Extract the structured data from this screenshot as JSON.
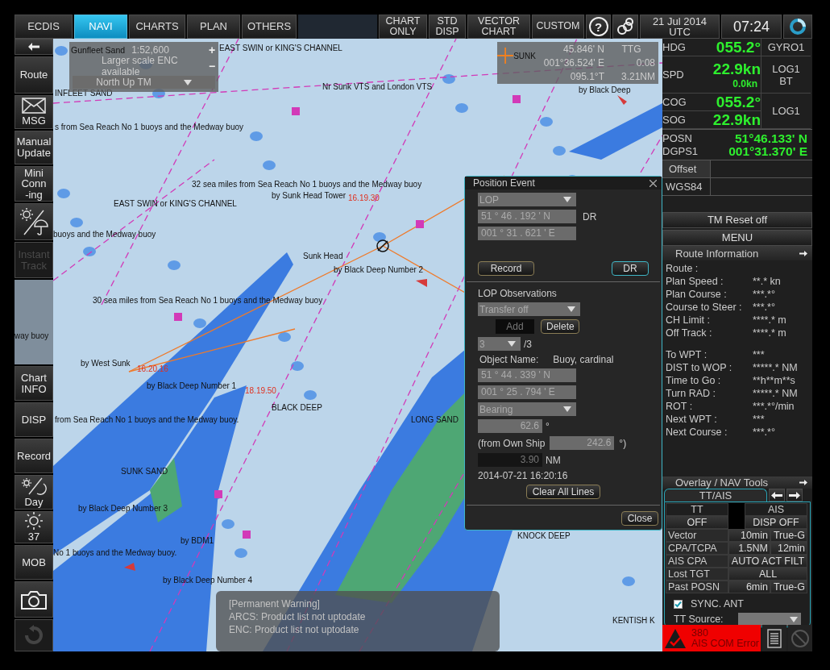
{
  "top_bar": {
    "tabs": [
      {
        "label": "ECDIS",
        "selected": false
      },
      {
        "label": "NAVI",
        "selected": true
      },
      {
        "label": "CHARTS",
        "selected": false
      },
      {
        "label": "PLAN",
        "selected": false
      },
      {
        "label": "OTHERS",
        "selected": false
      }
    ],
    "view_buttons": [
      {
        "lines": [
          "CHART",
          "ONLY"
        ]
      },
      {
        "lines": [
          "STD",
          "DISP"
        ]
      },
      {
        "lines": [
          "VECTOR",
          "CHART"
        ]
      },
      {
        "lines": [
          "CUSTOM"
        ]
      }
    ],
    "help": "?",
    "date": "21 Jul 2014",
    "zone": "UTC",
    "time": "07:24"
  },
  "sidebar": [
    {
      "kind": "back",
      "disabled": false
    },
    {
      "kind": "text",
      "lines": [
        "Route"
      ],
      "disabled": false
    },
    {
      "kind": "envelope",
      "lines": [
        "MSG"
      ],
      "disabled": false
    },
    {
      "kind": "text",
      "lines": [
        "Manual",
        "Update"
      ],
      "disabled": false
    },
    {
      "kind": "text",
      "lines": [
        "Mini",
        "Conn",
        "-ing"
      ],
      "disabled": false
    },
    {
      "kind": "weather",
      "disabled": false
    },
    {
      "kind": "text",
      "lines": [
        "Instant",
        "Track"
      ],
      "disabled": true
    },
    {
      "kind": "gap"
    },
    {
      "kind": "text",
      "lines": [
        "Chart",
        "INFO"
      ],
      "disabled": false
    },
    {
      "kind": "text",
      "lines": [
        "DISP"
      ],
      "disabled": false
    },
    {
      "kind": "text",
      "lines": [
        "Record"
      ],
      "disabled": false
    },
    {
      "kind": "daynight",
      "lines": [
        "Day"
      ],
      "disabled": false
    },
    {
      "kind": "brightness",
      "lines": [
        "37"
      ],
      "disabled": false
    },
    {
      "kind": "text",
      "lines": [
        "MOB"
      ],
      "disabled": false
    },
    {
      "kind": "camera",
      "disabled": false
    },
    {
      "kind": "undo",
      "disabled": true
    }
  ],
  "chart": {
    "scale_box": {
      "place": "Gunfleet Sand",
      "scale": "1:52,600",
      "notice": "Larger scale ENC available",
      "orientation": "North  Up TM",
      "zoom_in": "+",
      "zoom_out": "−"
    },
    "cursor_box": {
      "target": "SUNK",
      "lat": "45.846' N",
      "lon": "001°36.524' E",
      "bearing": "095.1°T",
      "ttg_label": "TTG",
      "ttg": "0:08",
      "distance": "3.21NM"
    },
    "labels": [
      {
        "text": "EAST SWIN or KING'S CHANNEL",
        "kind": "name"
      },
      {
        "text": "INFLEET SAND",
        "kind": "name"
      },
      {
        "text": "Nr Sunk VTS and London VTS",
        "kind": "name"
      },
      {
        "text": "by Black Deep",
        "kind": "name"
      },
      {
        "text": "s from Sea Reach No 1 buoys and the Medway buoy",
        "kind": "name"
      },
      {
        "text": "32 sea miles from Sea Reach No 1 buoys and the Medway buoy",
        "kind": "name"
      },
      {
        "text": "by Sunk Head Tower",
        "kind": "name"
      },
      {
        "text": "16.19.30",
        "kind": "time"
      },
      {
        "text": "EAST SWIN or KING'S CHANNEL",
        "kind": "name"
      },
      {
        "text": "buoys and the Medway buoy",
        "kind": "name"
      },
      {
        "text": "Sunk Head",
        "kind": "name"
      },
      {
        "text": "by Black Deep Number 2",
        "kind": "name"
      },
      {
        "text": "30 sea miles from Sea Reach No 1 buoys and the Medway buoy",
        "kind": "name"
      },
      {
        "text": "way buoy",
        "kind": "name"
      },
      {
        "text": "by West Sunk",
        "kind": "name"
      },
      {
        "text": "16.20.16",
        "kind": "time"
      },
      {
        "text": "by Black Deep Number 1",
        "kind": "name"
      },
      {
        "text": "18.19.50",
        "kind": "time"
      },
      {
        "text": "BLACK DEEP",
        "kind": "name"
      },
      {
        "text": "from Sea Reach No 1 buoys and the Medway buoy.",
        "kind": "name"
      },
      {
        "text": "LONG SAND",
        "kind": "name"
      },
      {
        "text": "SUNK SAND",
        "kind": "name"
      },
      {
        "text": "by Black Deep Number 3",
        "kind": "name"
      },
      {
        "text": "KNOCK DEEP",
        "kind": "name"
      },
      {
        "text": "by BDM1",
        "kind": "name"
      },
      {
        "text": "No 1 buoys and the Medway buoy.",
        "kind": "name"
      },
      {
        "text": "by Black Deep Number 4",
        "kind": "name"
      },
      {
        "text": "KENTISH K",
        "kind": "name"
      }
    ],
    "warning": {
      "title": "[Permanent Warning]",
      "lines": [
        "ARCS: Product list not uptodate",
        "ENC: Product list not uptodate"
      ]
    }
  },
  "position_event": {
    "title": "Position Event",
    "mode": "LOP",
    "lat": "51 ° 46 . 192 ' N",
    "lat_note": "DR",
    "lon": "001 ° 31 . 621 ' E",
    "buttons": [
      {
        "label": "Record",
        "selected": false
      },
      {
        "label": "DR",
        "selected": true
      }
    ],
    "section": "LOP Observations",
    "transfer": "Transfer off",
    "add": {
      "label": "Add",
      "disabled": true
    },
    "delete": {
      "label": "Delete",
      "disabled": false
    },
    "index": "3",
    "count": "/3",
    "object_label": "Object Name:",
    "object_value": "Buoy, cardinal",
    "obj_lat": "51 ° 44 . 339 ' N",
    "obj_lon": "001 ° 25 . 794 ' E",
    "measure": "Bearing",
    "bearing": "62.6",
    "bearing_unit": "°",
    "own_ship_label": "(from Own Ship",
    "own_ship_value": "242.6",
    "own_ship_unit": "°)",
    "distance": {
      "value": "3.90",
      "disabled": true
    },
    "distance_unit": "NM",
    "timestamp": "2014-07-21 16:20:16",
    "clear": "Clear All Lines",
    "close": "Close"
  },
  "own_ship": {
    "hdg": {
      "label": "HDG",
      "value": "055.2°",
      "source": "GYRO1"
    },
    "spd": {
      "label": "SPD",
      "value": "22.9kn",
      "sub": "0.0kn",
      "source": "LOG1\nBT"
    },
    "cog": {
      "label": "COG",
      "value": "055.2°"
    },
    "sog": {
      "label": "SOG",
      "value": "22.9kn"
    },
    "cog_sog_source": "LOG1",
    "posn": {
      "labels": [
        "POSN",
        "DGPS1"
      ],
      "lat": "51°46.133' N",
      "lon": "001°31.370' E"
    },
    "offset": "Offset",
    "datum": "WGS84",
    "tm_reset": "TM Reset off",
    "menu": "MENU"
  },
  "route_information": {
    "title": "Route Information",
    "groups": [
      [
        {
          "label": "Route :"
        },
        {
          "label": "Plan Speed :",
          "value": "**.* kn"
        },
        {
          "label": "Plan Course :",
          "value": "***.*°"
        },
        {
          "label": "Course to Steer :",
          "value": "***.*°"
        },
        {
          "label": "CH Limit :",
          "value": "****.* m"
        },
        {
          "label": "Off Track :",
          "value": "****.* m"
        }
      ],
      [
        {
          "label": "To WPT :",
          "value": "***"
        },
        {
          "label": "DIST to WOP :",
          "value": "*****.* NM"
        },
        {
          "label": "Time to Go :",
          "value": "**h**m**s"
        },
        {
          "label": "Turn RAD :",
          "value": "*****.* NM"
        },
        {
          "label": "ROT :",
          "value": "***.*°/min"
        },
        {
          "label": "Next WPT :",
          "value": "***"
        },
        {
          "label": "Next Course :",
          "value": "***.*°"
        }
      ]
    ]
  },
  "overlay_tools": {
    "title": "Overlay / NAV Tools",
    "tab": "TT/AIS",
    "heads": [
      {
        "label": "TT",
        "value": "OFF"
      },
      {
        "label": "AIS",
        "value": "DISP OFF"
      }
    ],
    "rows": [
      {
        "label": "Vector",
        "values": [
          "10min",
          "True-G"
        ]
      },
      {
        "label": "CPA/TCPA",
        "values": [
          "1.5NM",
          "12min"
        ]
      },
      {
        "label": "AIS CPA",
        "values": [
          "AUTO ACT FILT"
        ]
      },
      {
        "label": "Lost TGT",
        "values": [
          "ALL"
        ]
      },
      {
        "label": "Past POSN",
        "values": [
          "6min",
          "True-G"
        ]
      }
    ],
    "sync": {
      "label": "SYNC. ANT",
      "checked": true
    },
    "tt_source": "TT Source:"
  },
  "alarm": {
    "code": "380",
    "message": "AIS COM Error"
  }
}
